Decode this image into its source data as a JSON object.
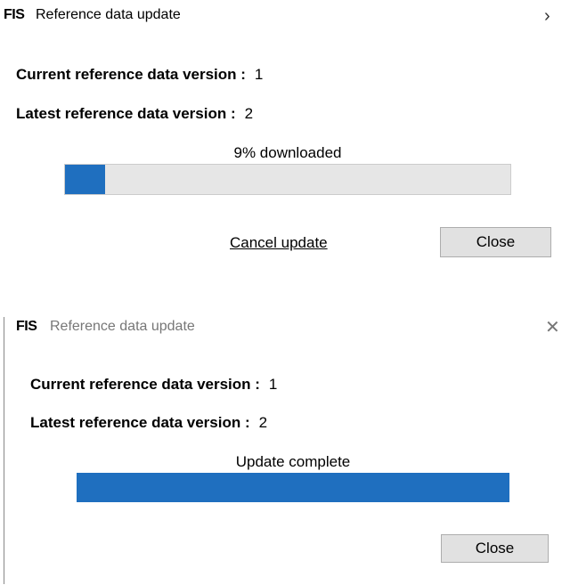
{
  "dialogs": [
    {
      "logo": "FIS",
      "title": "Reference data update",
      "title_button_icon": "chevron-right-icon",
      "title_button_glyph": "›",
      "current_version_label": "Current reference data version :",
      "current_version_value": "1",
      "latest_version_label": "Latest reference data version :",
      "latest_version_value": "2",
      "progress_caption": "9% downloaded",
      "progress_fraction": 0.09,
      "cancel_label": "Cancel update",
      "close_label": "Close"
    },
    {
      "logo": "FIS",
      "title": "Reference data update",
      "title_button_icon": "close-icon",
      "title_button_glyph": "✕",
      "current_version_label": "Current reference data version :",
      "current_version_value": "1",
      "latest_version_label": "Latest reference data version :",
      "latest_version_value": "2",
      "progress_caption": "Update complete",
      "progress_fraction": 1.0,
      "close_label": "Close"
    }
  ],
  "colors": {
    "progress_fill": "#1f6fbf",
    "progress_track": "#e6e6e6",
    "button_face": "#e1e1e1"
  }
}
